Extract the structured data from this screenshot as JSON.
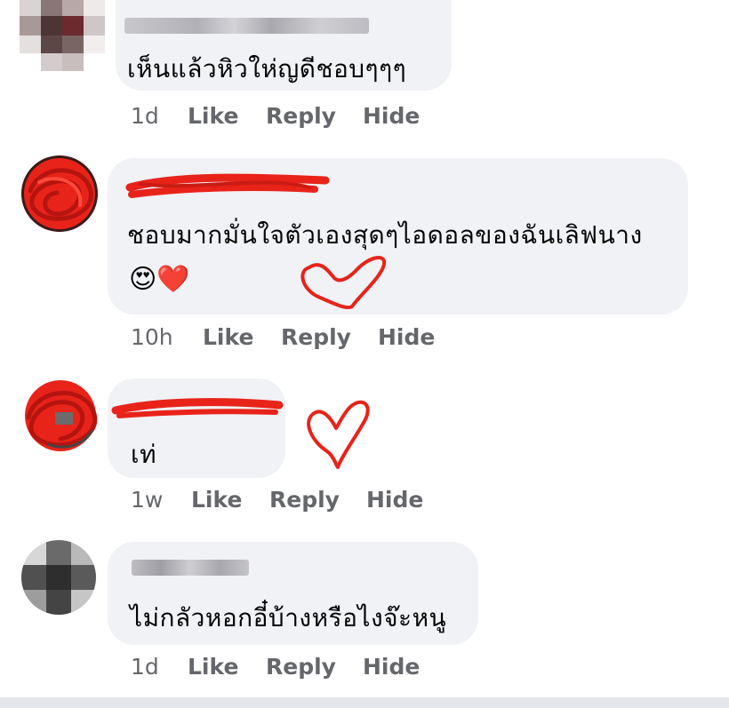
{
  "accent_red": "#e8231a",
  "bubble_color": "#f0f2f5",
  "actions": {
    "like": "Like",
    "reply": "Reply",
    "hide": "Hide"
  },
  "comments": [
    {
      "text": "เห็นแล้วหิวให่ญดีชอบๆๆๆ",
      "time": "1d",
      "author_redacted": true
    },
    {
      "text": "ชอบมากมั่นใจตัวเองสุดๆไอดอลของฉันเลิฟนาง",
      "emoji": "😍❤️",
      "time": "10h",
      "author_redacted": true
    },
    {
      "text": "เท่",
      "time": "1w",
      "author_redacted": true
    },
    {
      "text": "ไม่กลัวหอกอี๋บ้างหรือไงจ๊ะหนู",
      "time": "1d",
      "author_redacted": true
    }
  ]
}
